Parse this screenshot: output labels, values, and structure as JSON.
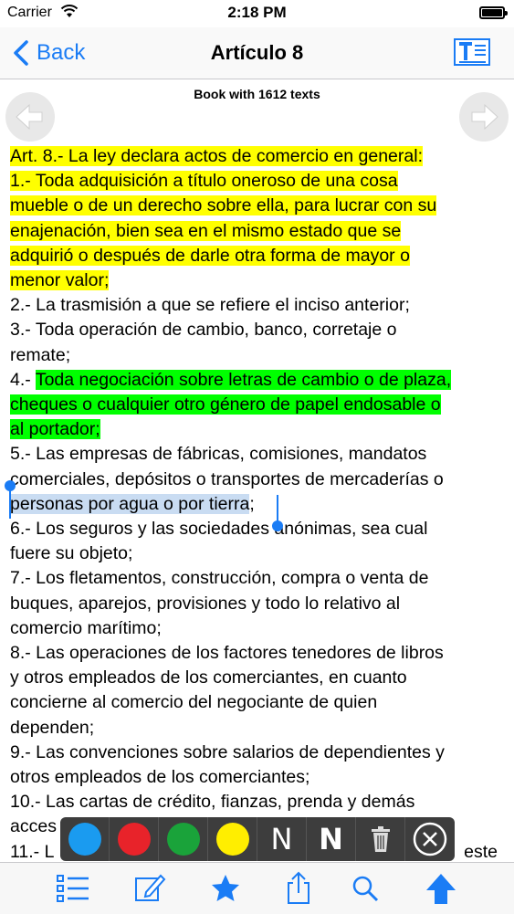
{
  "status_bar": {
    "carrier": "Carrier",
    "time": "2:18 PM",
    "battery_level": 0.9
  },
  "nav": {
    "back_label": "Back",
    "title": "Artículo 8",
    "text_format_icon": "text-format-icon"
  },
  "book_info": "Book with 1612 texts",
  "article": {
    "lines": [
      "Art. 8.- La ley declara actos de comercio en general:",
      "1.- Toda adquisición a título oneroso de una cosa",
      "mueble o de un derecho sobre ella, para lucrar con su",
      "enajenación, bien sea en el mismo estado que se",
      "adquirió o después de darle otra forma de mayor o",
      "menor valor;",
      "2.- La trasmisión a que se refiere el inciso anterior;",
      "3.- Toda operación de cambio, banco, corretaje o",
      "remate;",
      "4.- ",
      "Toda negociación sobre letras de cambio o de plaza,",
      "cheques o cualquier otro género de papel endosable o",
      "al portador;",
      "5.- Las empresas de fábricas, comisiones, mandatos",
      "comerciales, depósitos o transportes de mercaderías o",
      "personas por agua o por tierra",
      ";",
      "6.- Los seguros y las sociedades anónimas, sea cual",
      "fuere su objeto;",
      "7.- Los fletamentos, construcción, compra o venta de",
      "buques, aparejos, provisiones y todo lo relativo al",
      "comercio marítimo;",
      "8.- Las operaciones de los factores tenedores de libros",
      "y otros empleados de los comerciantes, en cuanto",
      "concierne al comercio del negociante de quien",
      "dependen;",
      "9.- Las convenciones sobre salarios de dependientes y",
      "otros empleados de los comerciantes;",
      "10.- Las cartas de crédito, fianzas, prenda y demás",
      "acces",
      "11.- L",
      "este"
    ]
  },
  "highlight_toolbar": {
    "colors": [
      "#1a9bf0",
      "#e8232a",
      "#1aa33a",
      "#ffee00"
    ],
    "note_label": "N",
    "note_bold_label": "N"
  },
  "colors": {
    "accent": "#1a7cf5",
    "yellow_highlight": "#ffff00",
    "green_highlight": "#00ff00",
    "selection": "#c9dcf2"
  }
}
